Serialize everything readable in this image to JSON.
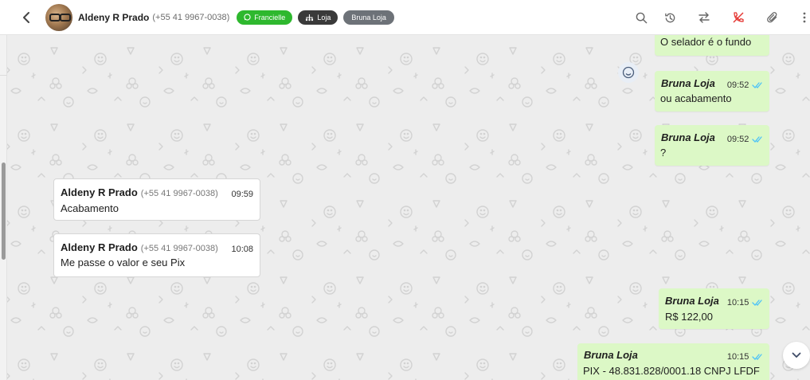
{
  "header": {
    "contact_name": "Aldeny R Prado",
    "contact_phone": "(+55 41 9967-0038)",
    "tags": [
      {
        "label": "Francielle",
        "icon": "whatsapp-icon",
        "color": "#2eb82e"
      },
      {
        "label": "Loja",
        "icon": "sitemap-icon",
        "color": "#3a3a3a"
      },
      {
        "label": "Bruna Loja",
        "color": "#6d7278"
      }
    ],
    "icons": [
      "search-icon",
      "history-icon",
      "transfer-icon",
      "missed-call-icon",
      "paperclip-icon",
      "more-vertical-icon"
    ]
  },
  "messages": [
    {
      "direction": "out",
      "sender": "",
      "time": "",
      "text": "O selador é o fundo"
    },
    {
      "direction": "out",
      "sender": "Bruna Loja",
      "time": "09:52",
      "text": "ou acabamento"
    },
    {
      "direction": "out",
      "sender": "Bruna Loja",
      "time": "09:52",
      "text": "?"
    },
    {
      "direction": "in",
      "sender": "Aldeny R Prado",
      "phone": "(+55 41 9967-0038)",
      "time": "09:59",
      "text": "Acabamento"
    },
    {
      "direction": "in",
      "sender": "Aldeny R Prado",
      "phone": "(+55 41 9967-0038)",
      "time": "10:08",
      "text": "Me passe o valor e seu Pix"
    },
    {
      "direction": "out",
      "sender": "Bruna Loja",
      "time": "10:15",
      "text": "R$ 122,00"
    },
    {
      "direction": "out",
      "sender": "Bruna Loja",
      "time": "10:15",
      "text": "PIX - 48.831.828/0001.18 CNPJ LFDF"
    }
  ],
  "colors": {
    "outgoing_bubble": "#dcf8c6",
    "incoming_bubble": "#ffffff",
    "read_ticks": "#4fc3f7",
    "chat_background": "#ededed"
  }
}
